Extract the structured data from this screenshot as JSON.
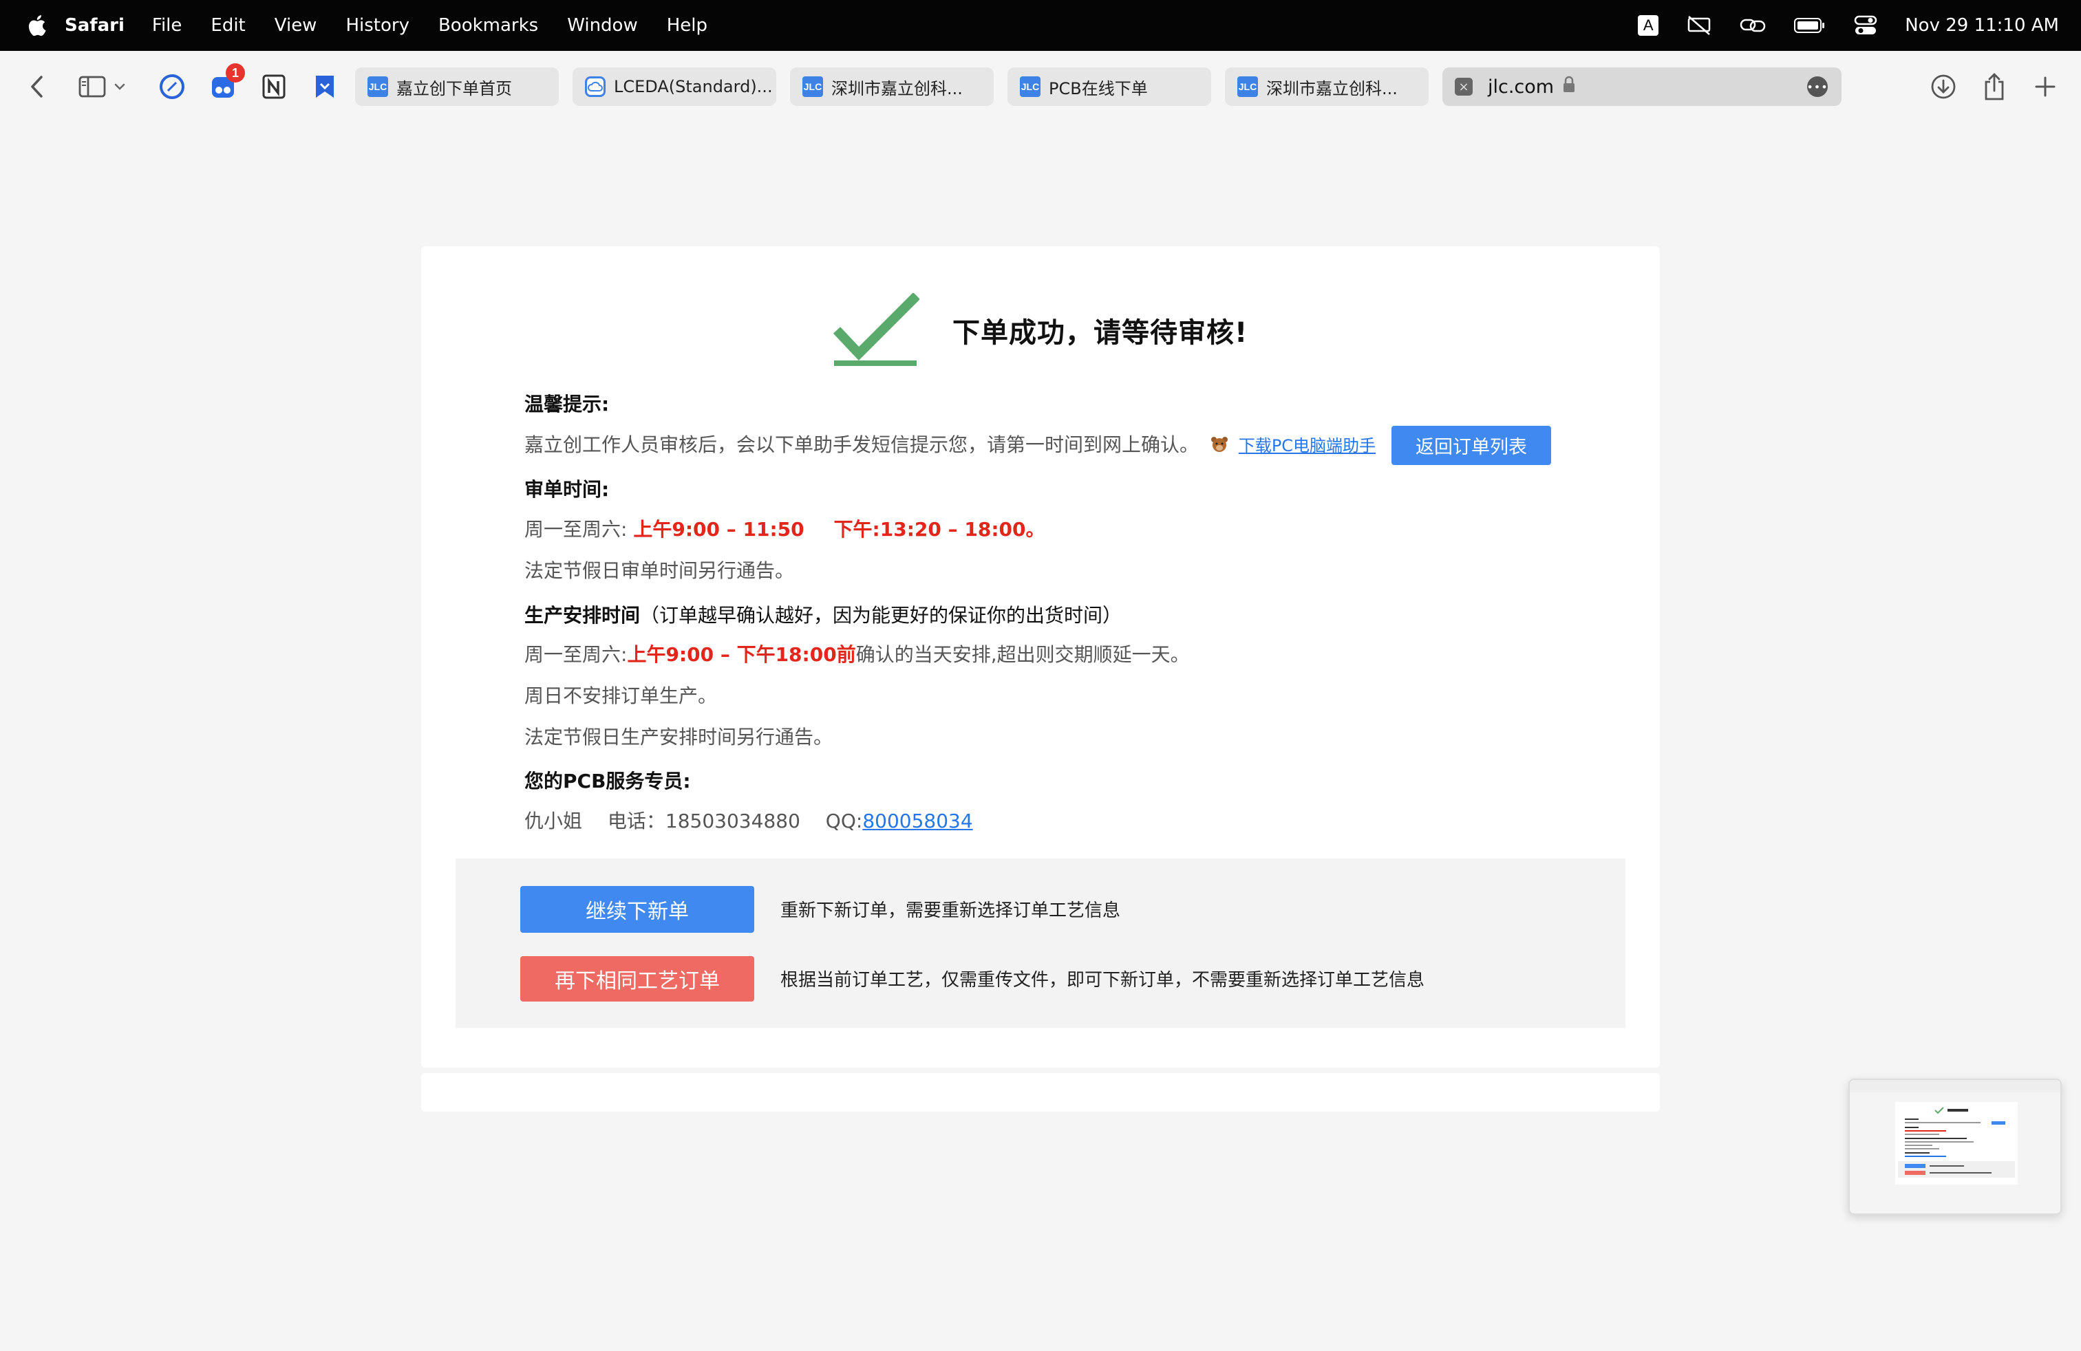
{
  "menubar": {
    "app": "Safari",
    "items": [
      "File",
      "Edit",
      "View",
      "History",
      "Bookmarks",
      "Window",
      "Help"
    ],
    "input_indicator": "A",
    "clock": "Nov 29  11:10 AM"
  },
  "toolbar": {
    "extension_badge": "1",
    "tabs": [
      {
        "label": "嘉立创下单首页",
        "favicon": "JLC"
      },
      {
        "label": "LCEDA(Standard)...",
        "favicon": ""
      },
      {
        "label": "深圳市嘉立创科...",
        "favicon": "JLC"
      },
      {
        "label": "PCB在线下单",
        "favicon": "JLC"
      },
      {
        "label": "深圳市嘉立创科...",
        "favicon": "JLC"
      }
    ],
    "active_tab": {
      "url": "jlc.com",
      "close": "×"
    }
  },
  "page": {
    "title": "下单成功，请等待审核!",
    "tip_heading": "温馨提示:",
    "tip_text": "嘉立创工作人员审核后，会以下单助手发短信提示您，请第一时间到网上确认。",
    "download_link": "下载PC电脑端助手",
    "return_button": "返回订单列表",
    "review_heading": "审单时间:",
    "review_prefix": "周一至周六:",
    "review_morning": "上午9:00 – 11:50",
    "review_afternoon": "下午:13:20 – 18:00。",
    "review_holiday": "法定节假日审单时间另行通告。",
    "production_heading": "生产安排时间",
    "production_note": "（订单越早确认越好，因为能更好的保证你的出货时间）",
    "production_prefix": "周一至周六:",
    "production_time": "上午9:00 – 下午18:00前",
    "production_suffix": "确认的当天安排,超出则交期顺延一天。",
    "production_sunday": "周日不安排订单生产。",
    "production_holiday": "法定节假日生产安排时间另行通告。",
    "service_heading": "您的PCB服务专员:",
    "service_name": "仇小姐",
    "service_phone": "电话：18503034880",
    "service_qq_label": "QQ:",
    "service_qq": "800058034",
    "continue_button": "继续下新单",
    "continue_desc": "重新下新订单，需要重新选择订单工艺信息",
    "repeat_button": "再下相同工艺订单",
    "repeat_desc": "根据当前订单工艺，仅需重传文件，即可下新订单，不需要重新选择订单工艺信息"
  },
  "colors": {
    "primary": "#4089f0",
    "danger": "#ee6a63",
    "highlight_red": "#e3261c",
    "check_green": "#5aab6b",
    "link": "#2676e8"
  }
}
